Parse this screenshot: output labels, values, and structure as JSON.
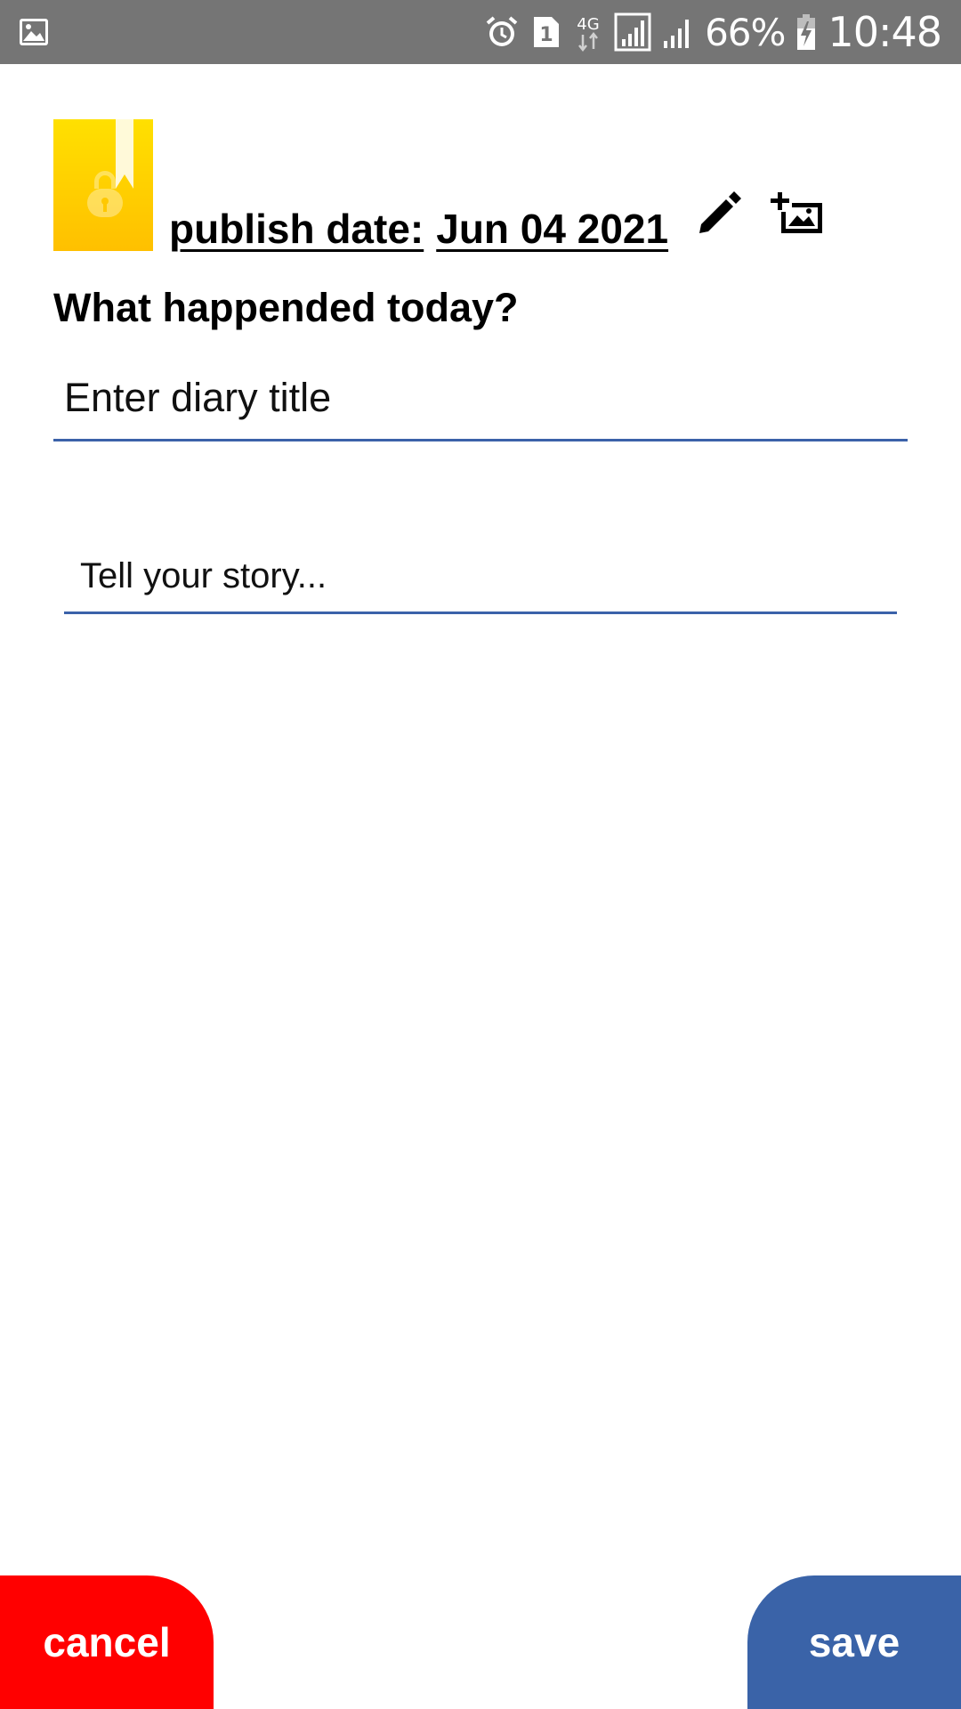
{
  "status_bar": {
    "left_icon": "image-notification-icon",
    "icons": [
      "alarm-icon",
      "sim-1-icon",
      "4g-data-icon",
      "signal-icon",
      "signal-icon-2",
      "battery-charging-icon"
    ],
    "network_label": "4G",
    "sim_label": "1",
    "battery": "66%",
    "time": "10:48",
    "background_color": "#757575"
  },
  "header": {
    "logo_icon": "diary-lock-logo-icon",
    "publish_label": "publish date:",
    "publish_date": "Jun 04 2021",
    "edit_icon": "pencil-icon",
    "add_photo_icon": "add-photo-icon"
  },
  "main": {
    "prompt": "What happended today?",
    "title_input": {
      "value": "",
      "placeholder": "Enter diary title"
    },
    "story_input": {
      "value": "",
      "placeholder": "Tell your story..."
    },
    "underline_color": "#3b62a9"
  },
  "footer": {
    "cancel_label": "cancel",
    "save_label": "save",
    "cancel_color": "#ff0000",
    "save_color": "#3a63a8"
  }
}
